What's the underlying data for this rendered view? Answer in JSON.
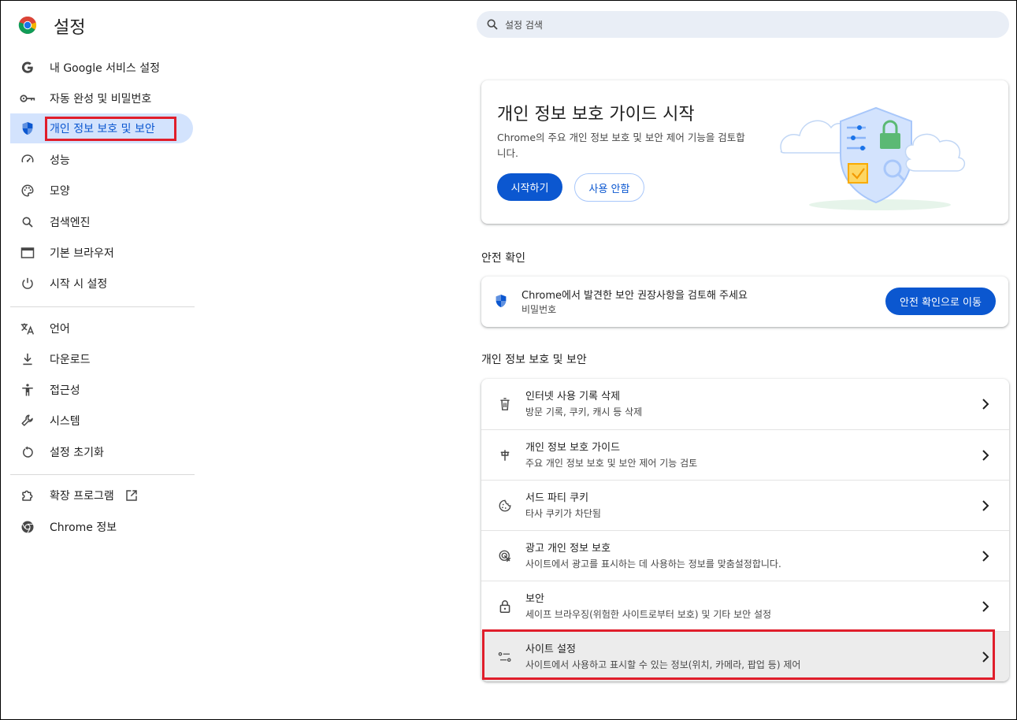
{
  "header": {
    "title": "설정",
    "search_placeholder": "설정 검색"
  },
  "sidebar": {
    "items": [
      {
        "label": "내 Google 서비스 설정",
        "icon": "google-g-icon"
      },
      {
        "label": "자동 완성 및 비밀번호",
        "icon": "key-icon"
      },
      {
        "label": "개인 정보 보호 및 보안",
        "icon": "shield-icon",
        "active": true
      },
      {
        "label": "성능",
        "icon": "speedometer-icon"
      },
      {
        "label": "모양",
        "icon": "palette-icon"
      },
      {
        "label": "검색엔진",
        "icon": "search-icon"
      },
      {
        "label": "기본 브라우저",
        "icon": "browser-window-icon"
      },
      {
        "label": "시작 시 설정",
        "icon": "power-icon"
      },
      {
        "label": "언어",
        "icon": "translate-icon"
      },
      {
        "label": "다운로드",
        "icon": "download-icon"
      },
      {
        "label": "접근성",
        "icon": "accessibility-icon"
      },
      {
        "label": "시스템",
        "icon": "wrench-icon"
      },
      {
        "label": "설정 초기화",
        "icon": "reset-icon"
      },
      {
        "label": "확장 프로그램",
        "icon": "puzzle-icon"
      },
      {
        "label": "Chrome 정보",
        "icon": "chrome-icon"
      }
    ]
  },
  "guide_card": {
    "title": "개인 정보 보호 가이드 시작",
    "description_line1": "Chrome의 주요 개인 정보 보호 및 보안 제어 기능을 검토합",
    "description_line2": "니다.",
    "start_button": "시작하기",
    "dismiss_button": "사용 안함"
  },
  "safety_check": {
    "section_title": "안전 확인",
    "text": "Chrome에서 발견한 보안 권장사항을 검토해 주세요",
    "subtext": "비밀번호",
    "button": "안전 확인으로 이동"
  },
  "privacy_section": {
    "section_title": "개인 정보 보호 및 보안",
    "rows": [
      {
        "title": "인터넷 사용 기록 삭제",
        "subtitle": "방문 기록, 쿠키, 캐시 등 삭제",
        "icon": "trash-icon"
      },
      {
        "title": "개인 정보 보호 가이드",
        "subtitle": "주요 개인 정보 보호 및 보안 제어 기능 검토",
        "icon": "privacy-guide-icon"
      },
      {
        "title": "서드 파티 쿠키",
        "subtitle": "타사 쿠키가 차단됨",
        "icon": "cookie-icon"
      },
      {
        "title": "광고 개인 정보 보호",
        "subtitle": "사이트에서 광고를 표시하는 데 사용하는 정보를 맞춤설정합니다.",
        "icon": "ad-privacy-icon"
      },
      {
        "title": "보안",
        "subtitle": "세이프 브라우징(위험한 사이트로부터 보호) 및 기타 보안 설정",
        "icon": "lock-icon"
      },
      {
        "title": "사이트 설정",
        "subtitle": "사이트에서 사용하고 표시할 수 있는 정보(위치, 카메라, 팝업 등) 제어",
        "icon": "sliders-icon"
      }
    ]
  },
  "colors": {
    "accent": "#0b57d0",
    "active_bg": "#d3e3fd",
    "highlight": "#e01e2b"
  }
}
